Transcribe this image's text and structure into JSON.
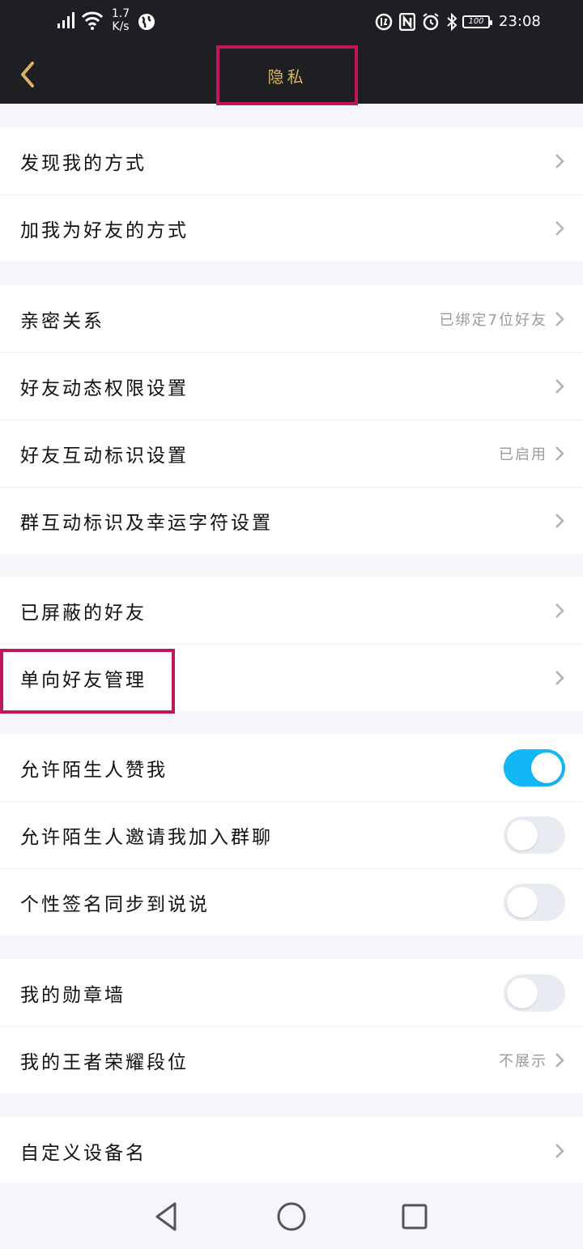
{
  "status_bar": {
    "speed_value": "1.7",
    "speed_unit": "K/s",
    "battery": "100",
    "time": "23:08"
  },
  "header": {
    "back_icon": "chevron-left-icon",
    "title": "隐私"
  },
  "groups": [
    {
      "items": [
        {
          "label": "发现我的方式",
          "value": ""
        },
        {
          "label": "加我为好友的方式",
          "value": ""
        }
      ]
    },
    {
      "items": [
        {
          "label": "亲密关系",
          "value": "已绑定7位好友"
        },
        {
          "label": "好友动态权限设置",
          "value": ""
        },
        {
          "label": "好友互动标识设置",
          "value": "已启用"
        },
        {
          "label": "群互动标识及幸运字符设置",
          "value": ""
        }
      ]
    },
    {
      "items": [
        {
          "label": "已屏蔽的好友",
          "value": ""
        },
        {
          "label": "单向好友管理",
          "value": ""
        }
      ]
    },
    {
      "items": [
        {
          "label": "允许陌生人赞我",
          "toggle": true
        },
        {
          "label": "允许陌生人邀请我加入群聊",
          "toggle": false
        },
        {
          "label": "个性签名同步到说说",
          "toggle": false
        }
      ]
    },
    {
      "items": [
        {
          "label": "我的勋章墙",
          "toggle": false
        },
        {
          "label": "我的王者荣耀段位",
          "value": "不展示"
        }
      ]
    },
    {
      "items": [
        {
          "label": "自定义设备名",
          "value": ""
        }
      ]
    }
  ],
  "colors": {
    "accent": "#12b7f5",
    "title": "#d9b35f",
    "highlight": "#c0165e"
  }
}
